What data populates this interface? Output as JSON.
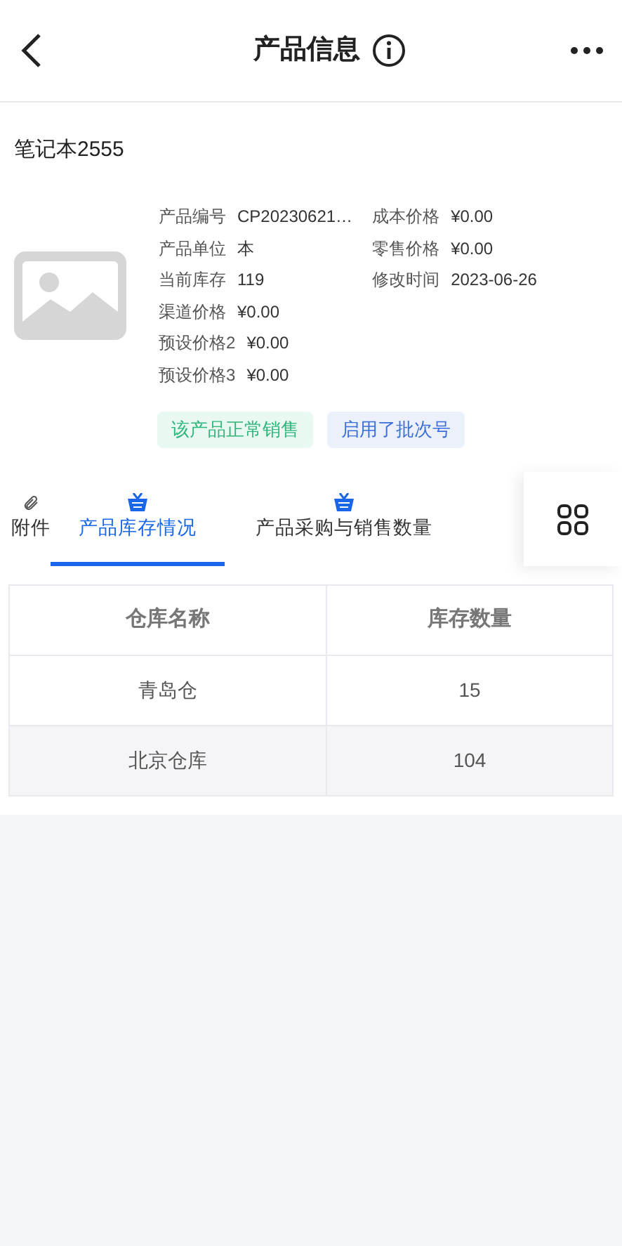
{
  "header": {
    "title": "产品信息"
  },
  "product": {
    "name": "笔记本2555",
    "left_fields": [
      {
        "label": "产品编号",
        "value": "CP20230621…"
      },
      {
        "label": "产品单位",
        "value": "本"
      },
      {
        "label": "当前库存",
        "value": "119"
      },
      {
        "label": "渠道价格",
        "value": "¥0.00"
      },
      {
        "label": "预设价格2",
        "value": "¥0.00"
      },
      {
        "label": "预设价格3",
        "value": "¥0.00"
      }
    ],
    "right_fields": [
      {
        "label": "成本价格",
        "value": "¥0.00"
      },
      {
        "label": "零售价格",
        "value": "¥0.00"
      },
      {
        "label": "修改时间",
        "value": "2023-06-26"
      }
    ],
    "tags": [
      {
        "text": "该产品正常销售",
        "color": "#2fb67c"
      },
      {
        "text": "启用了批次号",
        "color": "#3a6fd8"
      }
    ]
  },
  "tabs": [
    {
      "label": "附件",
      "kind": "attachments",
      "selected": false
    },
    {
      "label": "产品库存情况",
      "kind": "stock",
      "selected": true
    },
    {
      "label": "产品采购与销售数量",
      "kind": "stock",
      "selected": false
    }
  ],
  "table": {
    "columns": [
      "仓库名称",
      "库存数量"
    ],
    "rows": [
      [
        "青岛仓",
        "15"
      ],
      [
        "北京仓库",
        "104"
      ]
    ]
  }
}
